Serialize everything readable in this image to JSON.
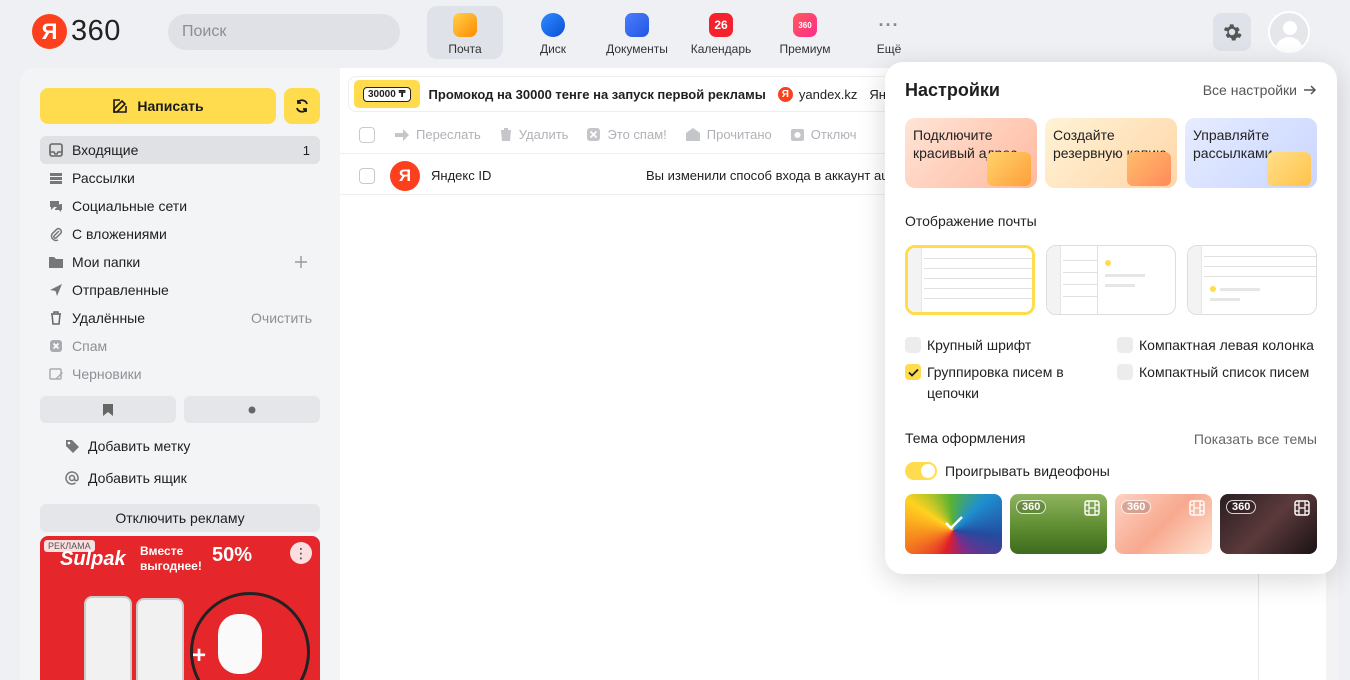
{
  "header": {
    "logo_letter": "Я",
    "logo_text": "360",
    "search_placeholder": "Поиск",
    "apps": [
      {
        "label": "Почта",
        "icon": "mail-icon"
      },
      {
        "label": "Диск",
        "icon": "disk-icon"
      },
      {
        "label": "Документы",
        "icon": "documents-icon"
      },
      {
        "label": "Календарь",
        "icon": "calendar-icon",
        "badge": "26"
      },
      {
        "label": "Премиум",
        "icon": "premium-icon",
        "badge": "360"
      },
      {
        "label": "Ещё",
        "icon": "more-icon"
      }
    ]
  },
  "sidebar": {
    "compose_label": "Написать",
    "folders": [
      {
        "label": "Входящие",
        "count": "1",
        "icon": "inbox-icon"
      },
      {
        "label": "Рассылки",
        "icon": "newsletters-icon"
      },
      {
        "label": "Социальные сети",
        "icon": "social-icon"
      },
      {
        "label": "С вложениями",
        "icon": "attachment-icon"
      },
      {
        "label": "Мои папки",
        "icon": "folder-icon"
      },
      {
        "label": "Отправленные",
        "icon": "sent-icon"
      },
      {
        "label": "Удалённые",
        "aside": "Очистить",
        "icon": "trash-icon"
      },
      {
        "label": "Спам",
        "icon": "spam-icon"
      },
      {
        "label": "Черновики",
        "icon": "drafts-icon"
      }
    ],
    "add_label": "Добавить метку",
    "add_mailbox": "Добавить ящик",
    "disable_ads": "Отключить рекламу",
    "ad": {
      "tag": "РЕКЛАМА",
      "brand": "Sulpak",
      "text_line1": "Вместе",
      "text_line2": "выгоднее!",
      "percent": "50%"
    }
  },
  "promo": {
    "badge": "30000 ₸",
    "text": "Промокод на 30000 тенге на запуск первой рекламы",
    "site": "yandex.kz",
    "tail": "Янд"
  },
  "toolbar": {
    "forward": "Переслать",
    "delete": "Удалить",
    "spam": "Это спам!",
    "read": "Прочитано",
    "disable": "Отключ"
  },
  "messages": [
    {
      "sender": "Яндекс ID",
      "subject": "Вы изменили способ входа в аккаунт auth"
    }
  ],
  "settings": {
    "title": "Настройки",
    "all_settings": "Все настройки",
    "cards": [
      "Подключите красивый адрес",
      "Создайте резервную копию",
      "Управляйте рассылками"
    ],
    "mail_display": "Отображение почты",
    "options": {
      "large_font": "Крупный шрифт",
      "compact_left": "Компактная левая колонка",
      "threading": "Группировка писем в цепочки",
      "compact_list": "Компактный список писем"
    },
    "theme_label": "Тема оформления",
    "show_all_themes": "Показать все темы",
    "play_video": "Проигрывать видеофоны",
    "theme_badge": "360"
  }
}
